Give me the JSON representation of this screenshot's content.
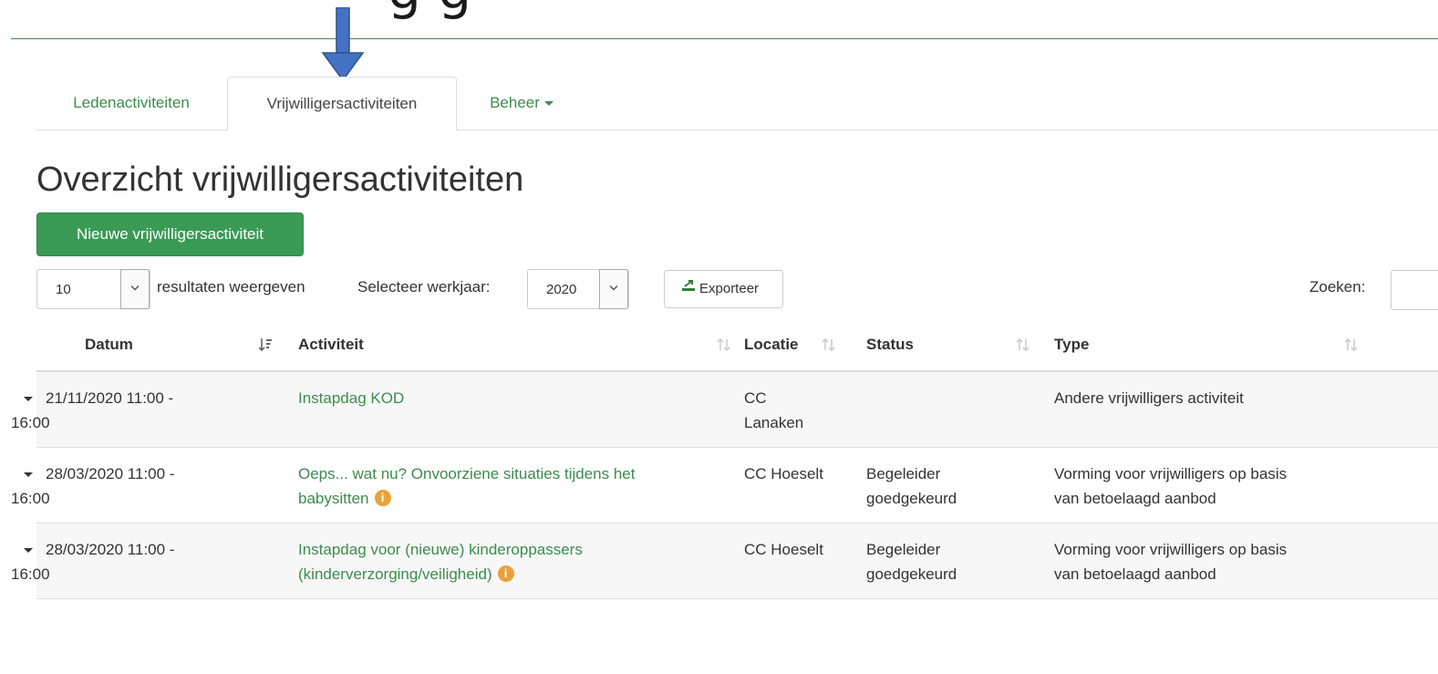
{
  "tabs": [
    {
      "label": "Ledenactiviteiten"
    },
    {
      "label": "Vrijwilligersactiviteiten"
    },
    {
      "label": "Beheer"
    }
  ],
  "title": "Overzicht vrijwilligersactiviteiten",
  "new_button": "Nieuwe vrijwilligersactiviteit",
  "length_select": {
    "value": "10",
    "label": "resultaten weergeven"
  },
  "year_select": {
    "label": "Selecteer werkjaar:",
    "value": "2020"
  },
  "export_button": "Exporteer",
  "search_label": "Zoeken:",
  "table": {
    "columns": [
      "Datum",
      "Activiteit",
      "Locatie",
      "Status",
      "Type"
    ],
    "rows": [
      {
        "date_line1": "21/11/2020 11:00 -",
        "date_line2": "16:00",
        "activity_line1": "Instapdag KOD",
        "activity_line2": "",
        "location_line1": "CC",
        "location_line2": "Lanaken",
        "status_line1": "",
        "status_line2": "",
        "type_line1": "Andere vrijwilligers activiteit",
        "type_line2": ""
      },
      {
        "date_line1": "28/03/2020 11:00 -",
        "date_line2": "16:00",
        "activity_line1": "Oeps... wat nu? Onvoorziene situaties tijdens het",
        "activity_line2": "babysitten",
        "location_line1": "CC Hoeselt",
        "location_line2": "",
        "status_line1": "Begeleider",
        "status_line2": "goedgekeurd",
        "type_line1": "Vorming voor vrijwilligers op basis",
        "type_line2": "van betoelaagd aanbod"
      },
      {
        "date_line1": "28/03/2020 11:00 -",
        "date_line2": "16:00",
        "activity_line1": "Instapdag voor (nieuwe) kinderoppassers",
        "activity_line2": "(kinderverzorging/veiligheid)",
        "location_line1": "CC Hoeselt",
        "location_line2": "",
        "status_line1": "Begeleider",
        "status_line2": "goedgekeurd",
        "type_line1": "Vorming voor vrijwilligers op basis",
        "type_line2": "van betoelaagd aanbod"
      }
    ]
  },
  "colors": {
    "brand_green": "#3c8c4c",
    "button_green": "#3a9a55",
    "info_orange": "#e8a33a",
    "arrow_blue": "#4472c4"
  }
}
